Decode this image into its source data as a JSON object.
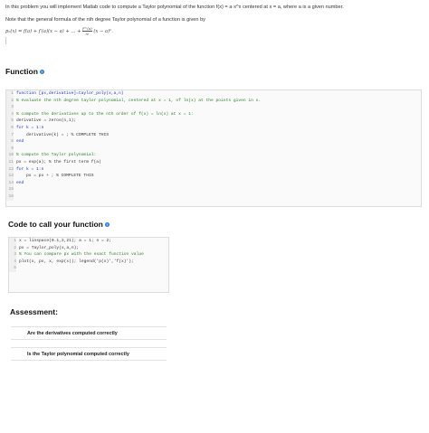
{
  "intro": {
    "line1": "In this problem you will implement Matlab code to compute a Taylor polynomial of the function  f(x) = a·x^x  centered at x = a, where a is a given number.",
    "line2": "Note that the general formula of the nth degree Taylor polynomial of a function is given by",
    "formula_left": "pₙ(x) = f(a) + f′(a)(x − a) + … + ",
    "formula_num": "f⁽ⁿ⁾(a)",
    "formula_den": "n!",
    "formula_right": " (x − a)ⁿ."
  },
  "function_section": {
    "title": "Function",
    "help_icon": "?",
    "lines": [
      {
        "n": "1",
        "t": "function [px,derivative]=taylor_poly(x,a,n)",
        "type": "kw"
      },
      {
        "n": "2",
        "t": "% evaluate the nth degree taylor polynomial, centered at x = 1, of ln(x) at the points given in x.",
        "type": "cm"
      },
      {
        "n": "3",
        "t": "",
        "type": ""
      },
      {
        "n": "4",
        "t": "% compute the derivatives up to the nth order of f(x) = ln(x) at x = 1:",
        "type": "cm"
      },
      {
        "n": "5",
        "t": "derivative = zeros(n,1);",
        "type": ""
      },
      {
        "n": "6",
        "t": "for k = 1:n",
        "type": "kw"
      },
      {
        "n": "7",
        "t": "    derivative(k) = ; % COMPLETE THIS",
        "type": ""
      },
      {
        "n": "8",
        "t": "end",
        "type": "kw"
      },
      {
        "n": "9",
        "t": "",
        "type": ""
      },
      {
        "n": "10",
        "t": "% compute the Taylor polynomial:",
        "type": "cm"
      },
      {
        "n": "11",
        "t": "px = exp(a); % the first term f(a)",
        "type": ""
      },
      {
        "n": "12",
        "t": "for k = 1:n",
        "type": "kw"
      },
      {
        "n": "13",
        "t": "    px = px + ; % COMPLETE THIS",
        "type": ""
      },
      {
        "n": "14",
        "t": "end",
        "type": "kw"
      },
      {
        "n": "15",
        "t": "",
        "type": ""
      },
      {
        "n": "16",
        "t": "",
        "type": ""
      }
    ]
  },
  "call_section": {
    "title": "Code to call your function",
    "help_icon": "?",
    "lines": [
      {
        "n": "1",
        "t": "x = linspace(0.1,2,21); a = 1; n = 2;",
        "type": ""
      },
      {
        "n": "2",
        "t": "px = Taylor_poly(x,a,n);",
        "type": ""
      },
      {
        "n": "3",
        "t": "% You can compare px with the exact function value",
        "type": "cm"
      },
      {
        "n": "4",
        "t": "plot(x, px, x, exp(x)); legend('p(x)','f(x)');",
        "type": ""
      },
      {
        "n": "5",
        "t": "",
        "type": ""
      }
    ]
  },
  "assessment": {
    "title": "Assessment:",
    "items": [
      "Are the derivatives computed correctly",
      "Is the Taylor polynomial computed correctly"
    ]
  }
}
